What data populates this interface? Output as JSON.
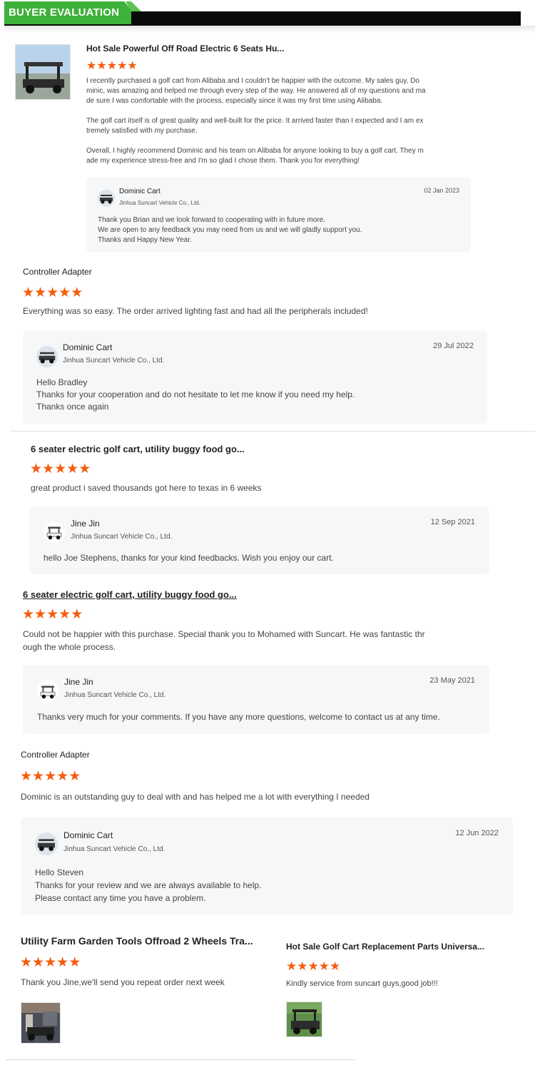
{
  "header": {
    "title": "BUYER EVALUATION"
  },
  "reviews": [
    {
      "title": "Hot Sale Powerful Off Road Electric 6 Seats Hu...",
      "stars": 5,
      "body": "I recently purchased a golf cart from Alibaba and I couldn't be happier with the outcome. My sales guy, Do\nminic, was amazing and helped me through every step of the way. He answered all of my questions and ma\nde sure I was comfortable with the process, especially since it was my first time using Alibaba.\n\nThe golf cart itself is of great quality and well-built for the price. It arrived faster than I expected and I am ex\ntremely satisfied with my purchase.\n\nOverall, I highly recommend Dominic and his team on Alibaba for anyone looking to buy a golf cart. They m\nade my experience stress-free and I'm so glad I chose them. Thank you for everything!",
      "reply": {
        "name": "Dominic Cart",
        "company": "Jinhua Suncart Vehicle Co., Ltd.",
        "date": "02 Jan 2023",
        "text": "Thank you Brian and we look forward to cooperating with  in future more.\nWe are open to any feedback you may need from us and we will gladly support you.\nThanks and Happy New Year."
      }
    },
    {
      "title": "Controller Adapter",
      "stars": 5,
      "body": "Everything was so easy. The order arrived lighting fast and had all the peripherals included!",
      "reply": {
        "name": "Dominic Cart",
        "company": "Jinhua Suncart Vehicle Co., Ltd.",
        "date": "29 Jul 2022",
        "text": "Hello Bradley\nThanks for your cooperation and do not hesitate to let me know if you need my help.\nThanks once again"
      }
    },
    {
      "title": "6 seater electric golf cart, utility buggy food go...",
      "stars": 5,
      "body": "great product i saved thousands got here to texas in 6 weeks",
      "reply": {
        "name": "Jine Jin",
        "company": "Jinhua Suncart Vehicle Co., Ltd.",
        "date": "12 Sep 2021",
        "text": "hello Joe Stephens, thanks for your kind feedbacks. Wish you enjoy our cart."
      }
    },
    {
      "title": "6 seater electric golf cart, utility buggy food go...",
      "stars": 5,
      "body": "Could not be happier with this purchase. Special thank you to Mohamed with Suncart. He was fantastic thr\nough the whole process.",
      "reply": {
        "name": "Jine Jin",
        "company": "Jinhua Suncart Vehicle Co., Ltd.",
        "date": "23 May 2021",
        "text": "Thanks very much for your comments. If you have any more questions, welcome to contact us at any time."
      }
    },
    {
      "title": "Controller Adapter",
      "stars": 5,
      "body": "Dominic is an outstanding guy to deal with and has helped me a lot with everything I needed",
      "reply": {
        "name": "Dominic Cart",
        "company": "Jinhua Suncart Vehicle Co., Ltd.",
        "date": "12 Jun 2022",
        "text": "Hello Steven\nThanks for your review and we are always available to help.\nPlease contact any time you have a problem."
      }
    },
    {
      "title": "Utility Farm Garden Tools Offroad 2 Wheels Tra...",
      "stars": 5,
      "body": "Thank you Jine,we'll send you repeat order next week"
    },
    {
      "title": "Hot Sale Golf Cart Replacement Parts Universa...",
      "stars": 5,
      "body": "Kindly service from suncart guys,good job!!!"
    }
  ],
  "colors": {
    "accent": "#f45d0f",
    "header_green": "#3eb13a",
    "header_black": "#0a0a0a",
    "card_bg": "#f6f7f8"
  },
  "icons": {
    "star": "star-icon",
    "avatar": "golf-cart-avatar-icon"
  }
}
